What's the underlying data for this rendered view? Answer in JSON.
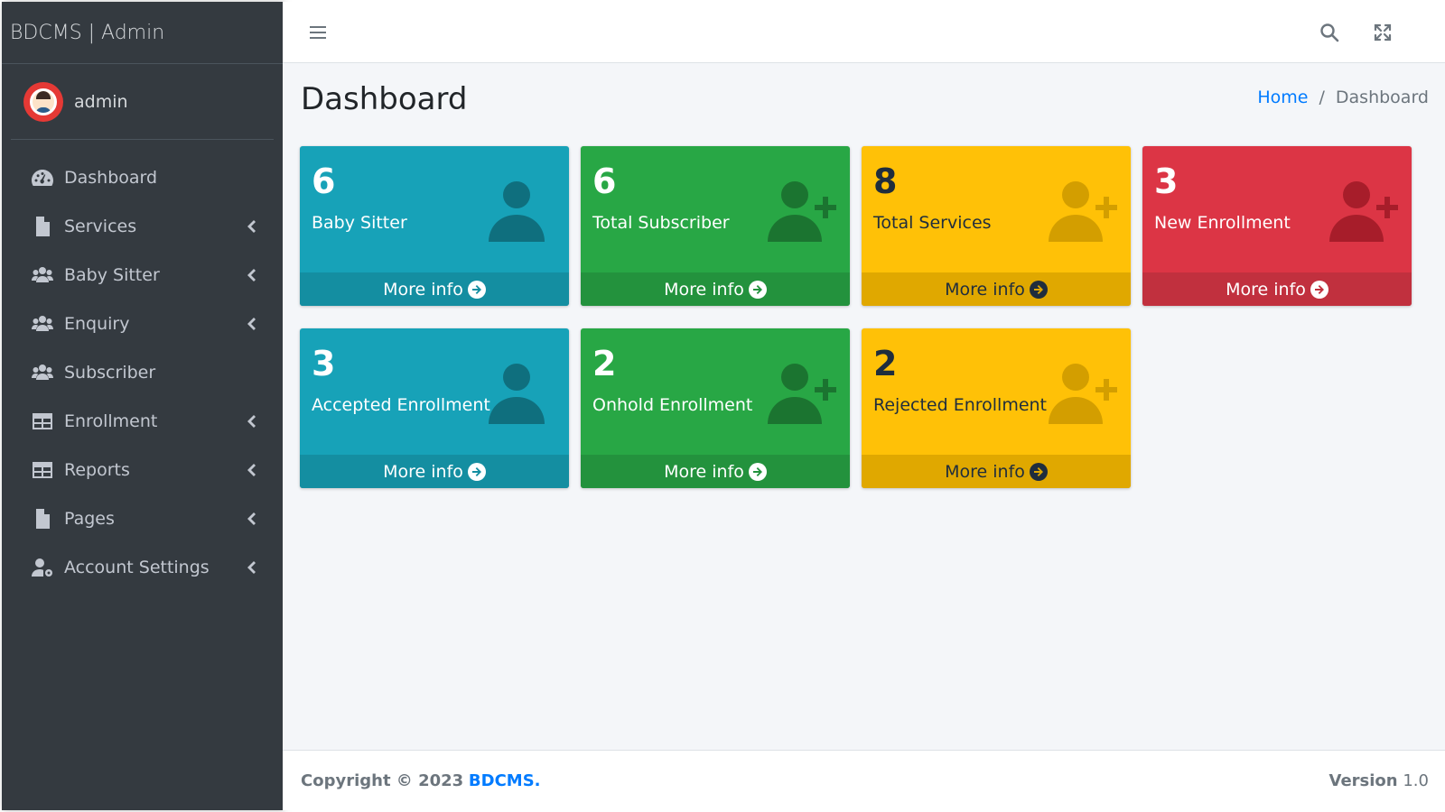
{
  "brand": {
    "title": "BDCMS | Admin"
  },
  "user": {
    "name": "admin"
  },
  "sidebar": {
    "items": [
      {
        "label": "Dashboard",
        "icon": "tachometer-icon",
        "has_children": false
      },
      {
        "label": "Services",
        "icon": "file-icon",
        "has_children": true
      },
      {
        "label": "Baby Sitter",
        "icon": "users-icon",
        "has_children": true
      },
      {
        "label": "Enquiry",
        "icon": "users-icon",
        "has_children": true
      },
      {
        "label": "Subscriber",
        "icon": "users-icon",
        "has_children": false
      },
      {
        "label": "Enrollment",
        "icon": "table-icon",
        "has_children": true
      },
      {
        "label": "Reports",
        "icon": "table-icon",
        "has_children": true
      },
      {
        "label": "Pages",
        "icon": "file-icon",
        "has_children": true
      },
      {
        "label": "Account Settings",
        "icon": "user-cog-icon",
        "has_children": true
      }
    ]
  },
  "topbar": {
    "menu_icon": "hamburger-icon",
    "search_icon": "search-icon",
    "fullscreen_icon": "expand-icon"
  },
  "page": {
    "title": "Dashboard",
    "breadcrumb": {
      "home": "Home",
      "separator": "/",
      "current": "Dashboard"
    }
  },
  "boxes": [
    {
      "number": "6",
      "label": "Baby Sitter",
      "more": "More info",
      "color": "#17a2b8",
      "icon": "user-icon"
    },
    {
      "number": "6",
      "label": "Total Subscriber",
      "more": "More info",
      "color": "#28a745",
      "icon": "user-plus-icon"
    },
    {
      "number": "8",
      "label": "Total Services",
      "more": "More info",
      "color": "#ffc107",
      "icon": "user-plus-icon"
    },
    {
      "number": "3",
      "label": "New Enrollment",
      "more": "More info",
      "color": "#dc3545",
      "icon": "user-plus-icon"
    },
    {
      "number": "3",
      "label": "Accepted Enrollment",
      "more": "More info",
      "color": "#17a2b8",
      "icon": "user-icon"
    },
    {
      "number": "2",
      "label": "Onhold Enrollment",
      "more": "More info",
      "color": "#28a745",
      "icon": "user-plus-icon"
    },
    {
      "number": "2",
      "label": "Rejected Enrollment",
      "more": "More info",
      "color": "#ffc107",
      "icon": "user-plus-icon"
    }
  ],
  "footer": {
    "copyright": "Copyright © 2023",
    "brand": "BDCMS.",
    "version_label": "Version",
    "version": "1.0"
  }
}
